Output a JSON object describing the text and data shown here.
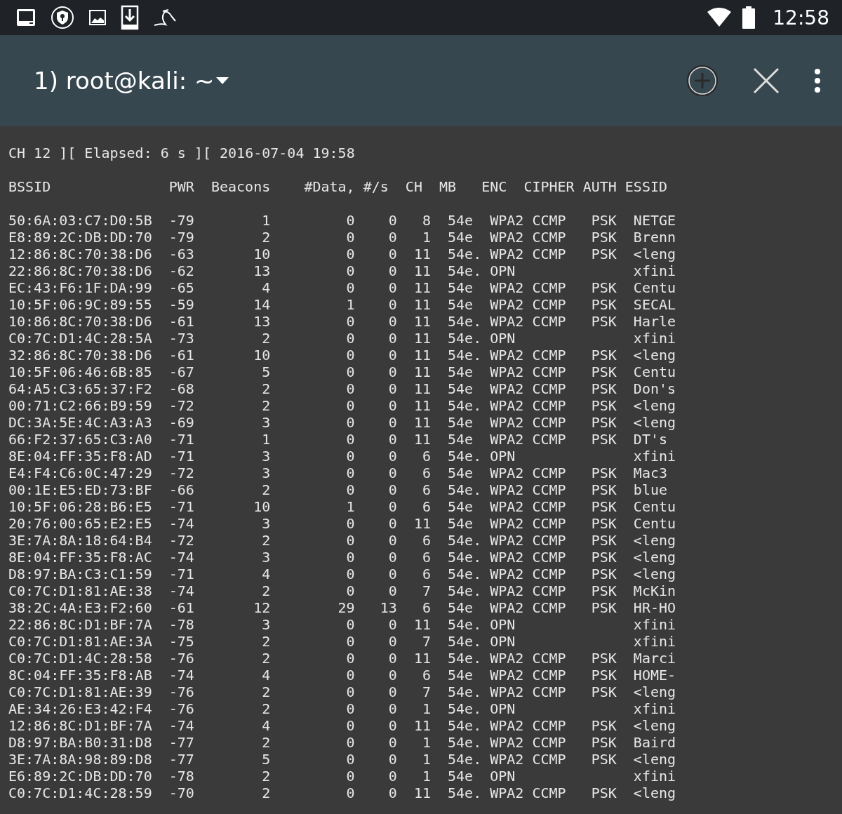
{
  "status_bar": {
    "time": "12:58"
  },
  "app_bar": {
    "title": "1) root@kali: ~"
  },
  "terminal": {
    "status_line": "CH 12 ][ Elapsed: 6 s ][ 2016-07-04 19:58",
    "columns": [
      "BSSID",
      "PWR",
      "Beacons",
      "#Data,",
      "#/s",
      "CH",
      "MB",
      "ENC",
      "CIPHER",
      "AUTH",
      "ESSID"
    ],
    "rows": [
      {
        "bssid": "50:6A:03:C7:D0:5B",
        "pwr": "-79",
        "beacons": "1",
        "data": "0",
        "per_s": "0",
        "ch": "8",
        "mb": "54e",
        "enc": "WPA2",
        "cipher": "CCMP",
        "auth": "PSK",
        "essid": "NETGE"
      },
      {
        "bssid": "E8:89:2C:DB:DD:70",
        "pwr": "-79",
        "beacons": "2",
        "data": "0",
        "per_s": "0",
        "ch": "1",
        "mb": "54e",
        "enc": "WPA2",
        "cipher": "CCMP",
        "auth": "PSK",
        "essid": "Brenn"
      },
      {
        "bssid": "12:86:8C:70:38:D6",
        "pwr": "-63",
        "beacons": "10",
        "data": "0",
        "per_s": "0",
        "ch": "11",
        "mb": "54e.",
        "enc": "WPA2",
        "cipher": "CCMP",
        "auth": "PSK",
        "essid": "<leng"
      },
      {
        "bssid": "22:86:8C:70:38:D6",
        "pwr": "-62",
        "beacons": "13",
        "data": "0",
        "per_s": "0",
        "ch": "11",
        "mb": "54e.",
        "enc": "OPN",
        "essid": "xfini"
      },
      {
        "bssid": "EC:43:F6:1F:DA:99",
        "pwr": "-65",
        "beacons": "4",
        "data": "0",
        "per_s": "0",
        "ch": "11",
        "mb": "54e",
        "enc": "WPA2",
        "cipher": "CCMP",
        "auth": "PSK",
        "essid": "Centu"
      },
      {
        "bssid": "10:5F:06:9C:89:55",
        "pwr": "-59",
        "beacons": "14",
        "data": "1",
        "per_s": "0",
        "ch": "11",
        "mb": "54e",
        "enc": "WPA2",
        "cipher": "CCMP",
        "auth": "PSK",
        "essid": "SECAL"
      },
      {
        "bssid": "10:86:8C:70:38:D6",
        "pwr": "-61",
        "beacons": "13",
        "data": "0",
        "per_s": "0",
        "ch": "11",
        "mb": "54e.",
        "enc": "WPA2",
        "cipher": "CCMP",
        "auth": "PSK",
        "essid": "Harle"
      },
      {
        "bssid": "C0:7C:D1:4C:28:5A",
        "pwr": "-73",
        "beacons": "2",
        "data": "0",
        "per_s": "0",
        "ch": "11",
        "mb": "54e.",
        "enc": "OPN",
        "essid": "xfini"
      },
      {
        "bssid": "32:86:8C:70:38:D6",
        "pwr": "-61",
        "beacons": "10",
        "data": "0",
        "per_s": "0",
        "ch": "11",
        "mb": "54e.",
        "enc": "WPA2",
        "cipher": "CCMP",
        "auth": "PSK",
        "essid": "<leng"
      },
      {
        "bssid": "10:5F:06:46:6B:85",
        "pwr": "-67",
        "beacons": "5",
        "data": "0",
        "per_s": "0",
        "ch": "11",
        "mb": "54e",
        "enc": "WPA2",
        "cipher": "CCMP",
        "auth": "PSK",
        "essid": "Centu"
      },
      {
        "bssid": "64:A5:C3:65:37:F2",
        "pwr": "-68",
        "beacons": "2",
        "data": "0",
        "per_s": "0",
        "ch": "11",
        "mb": "54e",
        "enc": "WPA2",
        "cipher": "CCMP",
        "auth": "PSK",
        "essid": "Don's"
      },
      {
        "bssid": "00:71:C2:66:B9:59",
        "pwr": "-72",
        "beacons": "2",
        "data": "0",
        "per_s": "0",
        "ch": "11",
        "mb": "54e.",
        "enc": "WPA2",
        "cipher": "CCMP",
        "auth": "PSK",
        "essid": "<leng"
      },
      {
        "bssid": "DC:3A:5E:4C:A3:A3",
        "pwr": "-69",
        "beacons": "3",
        "data": "0",
        "per_s": "0",
        "ch": "11",
        "mb": "54e",
        "enc": "WPA2",
        "cipher": "CCMP",
        "auth": "PSK",
        "essid": "<leng"
      },
      {
        "bssid": "66:F2:37:65:C3:A0",
        "pwr": "-71",
        "beacons": "1",
        "data": "0",
        "per_s": "0",
        "ch": "11",
        "mb": "54e",
        "enc": "WPA2",
        "cipher": "CCMP",
        "auth": "PSK",
        "essid": "DT's"
      },
      {
        "bssid": "8E:04:FF:35:F8:AD",
        "pwr": "-71",
        "beacons": "3",
        "data": "0",
        "per_s": "0",
        "ch": "6",
        "mb": "54e.",
        "enc": "OPN",
        "essid": "xfini"
      },
      {
        "bssid": "E4:F4:C6:0C:47:29",
        "pwr": "-72",
        "beacons": "3",
        "data": "0",
        "per_s": "0",
        "ch": "6",
        "mb": "54e",
        "enc": "WPA2",
        "cipher": "CCMP",
        "auth": "PSK",
        "essid": "Mac3"
      },
      {
        "bssid": "00:1E:E5:ED:73:BF",
        "pwr": "-66",
        "beacons": "2",
        "data": "0",
        "per_s": "0",
        "ch": "6",
        "mb": "54e.",
        "enc": "WPA2",
        "cipher": "CCMP",
        "auth": "PSK",
        "essid": "blue"
      },
      {
        "bssid": "10:5F:06:28:B6:E5",
        "pwr": "-71",
        "beacons": "10",
        "data": "1",
        "per_s": "0",
        "ch": "6",
        "mb": "54e",
        "enc": "WPA2",
        "cipher": "CCMP",
        "auth": "PSK",
        "essid": "Centu"
      },
      {
        "bssid": "20:76:00:65:E2:E5",
        "pwr": "-74",
        "beacons": "3",
        "data": "0",
        "per_s": "0",
        "ch": "11",
        "mb": "54e",
        "enc": "WPA2",
        "cipher": "CCMP",
        "auth": "PSK",
        "essid": "Centu"
      },
      {
        "bssid": "3E:7A:8A:18:64:B4",
        "pwr": "-72",
        "beacons": "2",
        "data": "0",
        "per_s": "0",
        "ch": "6",
        "mb": "54e.",
        "enc": "WPA2",
        "cipher": "CCMP",
        "auth": "PSK",
        "essid": "<leng"
      },
      {
        "bssid": "8E:04:FF:35:F8:AC",
        "pwr": "-74",
        "beacons": "3",
        "data": "0",
        "per_s": "0",
        "ch": "6",
        "mb": "54e.",
        "enc": "WPA2",
        "cipher": "CCMP",
        "auth": "PSK",
        "essid": "<leng"
      },
      {
        "bssid": "D8:97:BA:C3:C1:59",
        "pwr": "-71",
        "beacons": "4",
        "data": "0",
        "per_s": "0",
        "ch": "6",
        "mb": "54e.",
        "enc": "WPA2",
        "cipher": "CCMP",
        "auth": "PSK",
        "essid": "<leng"
      },
      {
        "bssid": "C0:7C:D1:81:AE:38",
        "pwr": "-74",
        "beacons": "2",
        "data": "0",
        "per_s": "0",
        "ch": "7",
        "mb": "54e.",
        "enc": "WPA2",
        "cipher": "CCMP",
        "auth": "PSK",
        "essid": "McKin"
      },
      {
        "bssid": "38:2C:4A:E3:F2:60",
        "pwr": "-61",
        "beacons": "12",
        "data": "29",
        "per_s": "13",
        "ch": "6",
        "mb": "54e",
        "enc": "WPA2",
        "cipher": "CCMP",
        "auth": "PSK",
        "essid": "HR-HO"
      },
      {
        "bssid": "22:86:8C:D1:BF:7A",
        "pwr": "-78",
        "beacons": "3",
        "data": "0",
        "per_s": "0",
        "ch": "11",
        "mb": "54e.",
        "enc": "OPN",
        "essid": "xfini"
      },
      {
        "bssid": "C0:7C:D1:81:AE:3A",
        "pwr": "-75",
        "beacons": "2",
        "data": "0",
        "per_s": "0",
        "ch": "7",
        "mb": "54e.",
        "enc": "OPN",
        "essid": "xfini"
      },
      {
        "bssid": "C0:7C:D1:4C:28:58",
        "pwr": "-76",
        "beacons": "2",
        "data": "0",
        "per_s": "0",
        "ch": "11",
        "mb": "54e.",
        "enc": "WPA2",
        "cipher": "CCMP",
        "auth": "PSK",
        "essid": "Marci"
      },
      {
        "bssid": "8C:04:FF:35:F8:AB",
        "pwr": "-74",
        "beacons": "4",
        "data": "0",
        "per_s": "0",
        "ch": "6",
        "mb": "54e",
        "enc": "WPA2",
        "cipher": "CCMP",
        "auth": "PSK",
        "essid": "HOME-"
      },
      {
        "bssid": "C0:7C:D1:81:AE:39",
        "pwr": "-76",
        "beacons": "2",
        "data": "0",
        "per_s": "0",
        "ch": "7",
        "mb": "54e.",
        "enc": "WPA2",
        "cipher": "CCMP",
        "auth": "PSK",
        "essid": "<leng"
      },
      {
        "bssid": "AE:34:26:E3:42:F4",
        "pwr": "-76",
        "beacons": "2",
        "data": "0",
        "per_s": "0",
        "ch": "1",
        "mb": "54e.",
        "enc": "OPN",
        "essid": "xfini"
      },
      {
        "bssid": "12:86:8C:D1:BF:7A",
        "pwr": "-74",
        "beacons": "4",
        "data": "0",
        "per_s": "0",
        "ch": "11",
        "mb": "54e.",
        "enc": "WPA2",
        "cipher": "CCMP",
        "auth": "PSK",
        "essid": "<leng"
      },
      {
        "bssid": "D8:97:BA:B0:31:D8",
        "pwr": "-77",
        "beacons": "2",
        "data": "0",
        "per_s": "0",
        "ch": "1",
        "mb": "54e.",
        "enc": "WPA2",
        "cipher": "CCMP",
        "auth": "PSK",
        "essid": "Baird"
      },
      {
        "bssid": "3E:7A:8A:98:89:D8",
        "pwr": "-77",
        "beacons": "5",
        "data": "0",
        "per_s": "0",
        "ch": "1",
        "mb": "54e.",
        "enc": "WPA2",
        "cipher": "CCMP",
        "auth": "PSK",
        "essid": "<leng"
      },
      {
        "bssid": "E6:89:2C:DB:DD:70",
        "pwr": "-78",
        "beacons": "2",
        "data": "0",
        "per_s": "0",
        "ch": "1",
        "mb": "54e",
        "enc": "OPN",
        "essid": "xfini"
      },
      {
        "bssid": "C0:7C:D1:4C:28:59",
        "pwr": "-70",
        "beacons": "2",
        "data": "0",
        "per_s": "0",
        "ch": "11",
        "mb": "54e.",
        "enc": "WPA2",
        "cipher": "CCMP",
        "auth": "PSK",
        "essid": "<leng"
      }
    ]
  }
}
